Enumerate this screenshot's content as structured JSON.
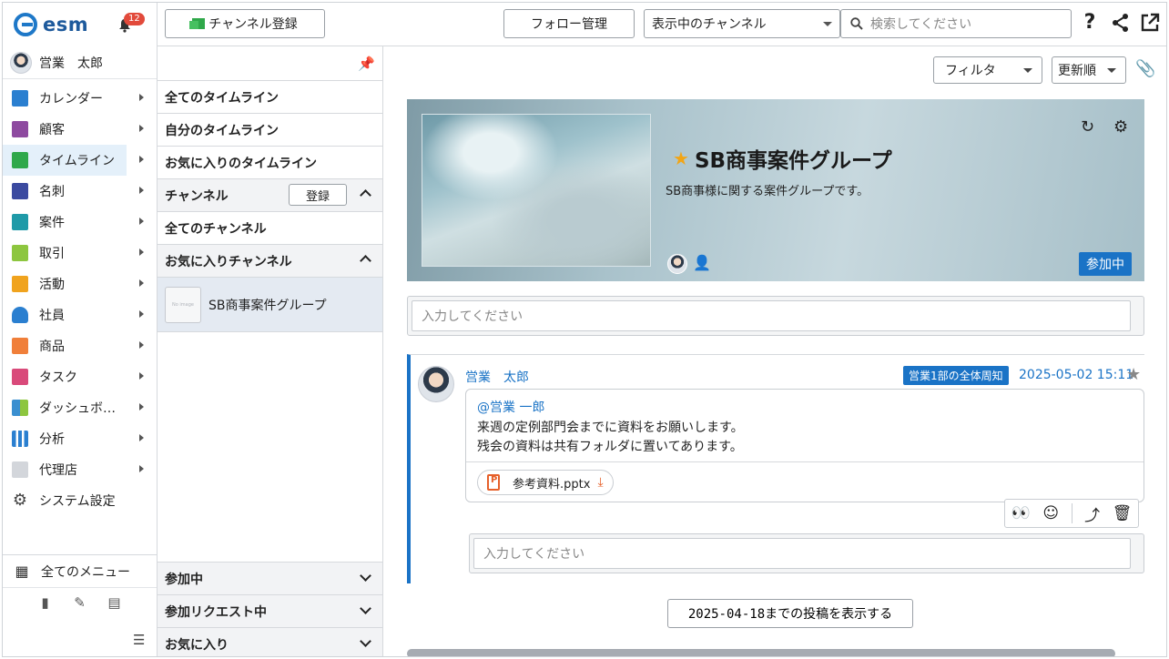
{
  "app": {
    "logo_text": "esm",
    "notification_count": "12"
  },
  "user": {
    "name": "営業　太郎"
  },
  "nav": {
    "items": [
      {
        "label": "カレンダー",
        "icon": "calendar-icon",
        "color": "#2a7fd0"
      },
      {
        "label": "顧客",
        "icon": "building-icon",
        "color": "#8e4aa0"
      },
      {
        "label": "タイムライン",
        "icon": "chat-icon",
        "color": "#2fa84a"
      },
      {
        "label": "名刺",
        "icon": "business-card-icon",
        "color": "#3b4aa0"
      },
      {
        "label": "案件",
        "icon": "folder-icon",
        "color": "#1f9aa8"
      },
      {
        "label": "取引",
        "icon": "deal-icon",
        "color": "#8dc63f"
      },
      {
        "label": "活動",
        "icon": "clipboard-icon",
        "color": "#f0a31e"
      },
      {
        "label": "社員",
        "icon": "person-icon",
        "color": "#2a7fd0"
      },
      {
        "label": "商品",
        "icon": "box-icon",
        "color": "#f07f3a"
      },
      {
        "label": "タスク",
        "icon": "task-icon",
        "color": "#d94a7a"
      },
      {
        "label": "ダッシュボ…",
        "icon": "dashboard-icon",
        "color": "#3a8fd0"
      },
      {
        "label": "分析",
        "icon": "chart-icon",
        "color": "#2a7fd0"
      },
      {
        "label": "代理店",
        "icon": "document-icon",
        "color": "#c8ccd2"
      }
    ],
    "settings_label": "システム設定",
    "all_menu_label": "全てのメニュー"
  },
  "topbar": {
    "channel_register_label": "チャンネル登録",
    "follow_label": "フォロー管理",
    "channel_select_value": "表示中のチャンネル",
    "search_placeholder": "検索してください"
  },
  "midpanel": {
    "timeline_all": "全てのタイムライン",
    "timeline_mine": "自分のタイムライン",
    "timeline_fav": "お気に入りのタイムライン",
    "channel_section": "チャンネル",
    "channel_register": "登録",
    "channel_all": "全てのチャンネル",
    "fav_channel_section": "お気に入りチャンネル",
    "fav_channel_item": "SB商事案件グループ",
    "no_image": "No image",
    "joined_section": "参加中",
    "requested_section": "参加リクエスト中",
    "favorites_section": "お気に入り"
  },
  "main": {
    "filter_label": "フィルタ",
    "sort_label": "更新順",
    "banner": {
      "title": "SB商事案件グループ",
      "description": "SB商事様に関する案件グループです。",
      "joined_label": "参加中"
    },
    "post_input_placeholder": "入力してください",
    "post": {
      "author": "営業　太郎",
      "tag": "営業1部の全体周知",
      "date": "2025-05-02 15:11",
      "mention": "@営業 一郎",
      "line1": "来週の定例部門会までに資料をお願いします。",
      "line2": "残会の資料は共有フォルダに置いてあります。",
      "attachment": "参考資料.pptx",
      "reply_placeholder": "入力してください"
    },
    "more_label": "2025-04-18までの投稿を表示する"
  }
}
